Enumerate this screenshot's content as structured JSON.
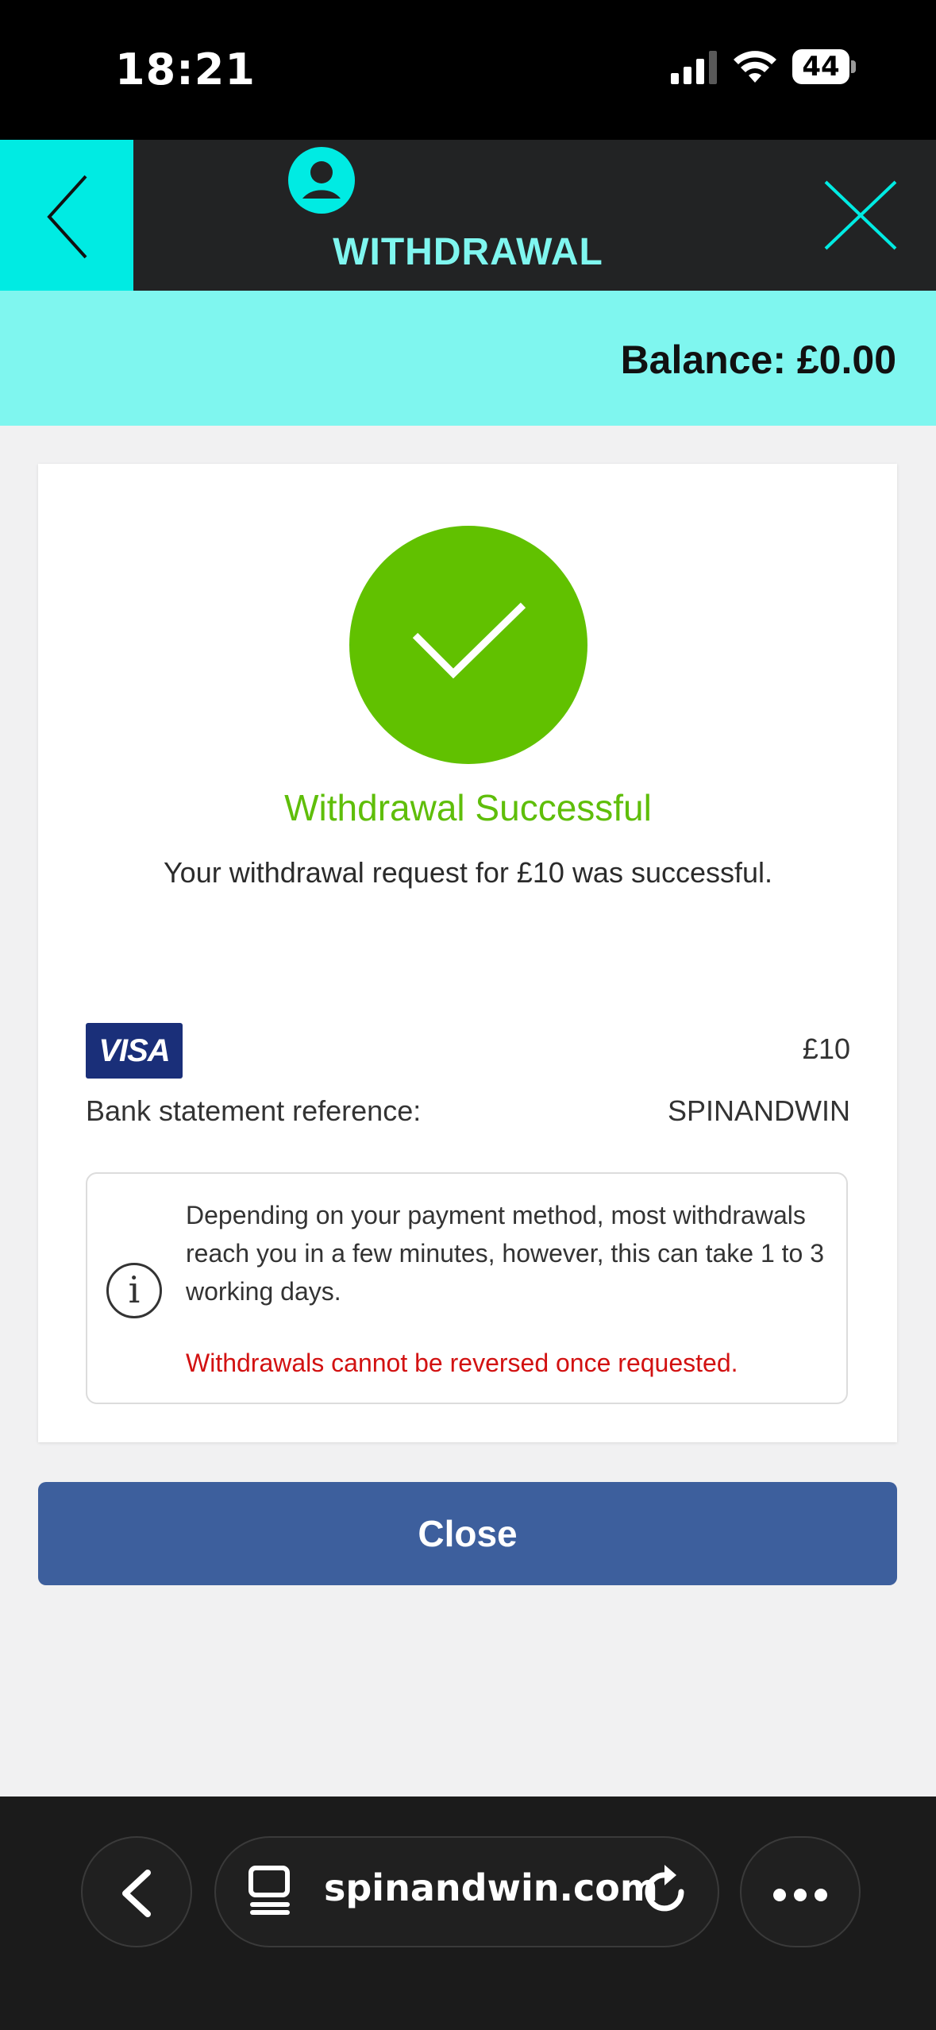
{
  "status_bar": {
    "time": "18:21",
    "battery": "44",
    "icons": [
      "signal-icon",
      "wifi-icon",
      "battery-icon"
    ]
  },
  "header": {
    "title": "WITHDRAWAL",
    "icons": [
      "back-chevron-icon",
      "user-icon",
      "close-icon"
    ],
    "colors": {
      "accent": "#00ebe3",
      "title": "#7ff6ef",
      "background": "#222324"
    }
  },
  "balance": {
    "text": "Balance: £0.00"
  },
  "result": {
    "title": "Withdrawal Successful",
    "message": "Your withdrawal request for £10 was successful.",
    "icon": "checkmark-icon",
    "color": "#61c100"
  },
  "payment": {
    "method_logo": "VISA",
    "amount": "£10",
    "reference_label": "Bank statement reference:",
    "reference_value": "SPINANDWIN"
  },
  "info": {
    "icon": "info-icon",
    "text": "Depending on your payment method, most withdrawals reach you in a few minutes, however, this can take 1 to 3 working days.",
    "warning": "Withdrawals cannot be reversed once requested.",
    "warning_color": "#d21111"
  },
  "actions": {
    "close_label": "Close",
    "close_color": "#3d5f9d"
  },
  "browser": {
    "url": "spinandwin.com",
    "icons": [
      "back-icon",
      "tabs-icon",
      "reload-icon",
      "more-icon"
    ]
  }
}
